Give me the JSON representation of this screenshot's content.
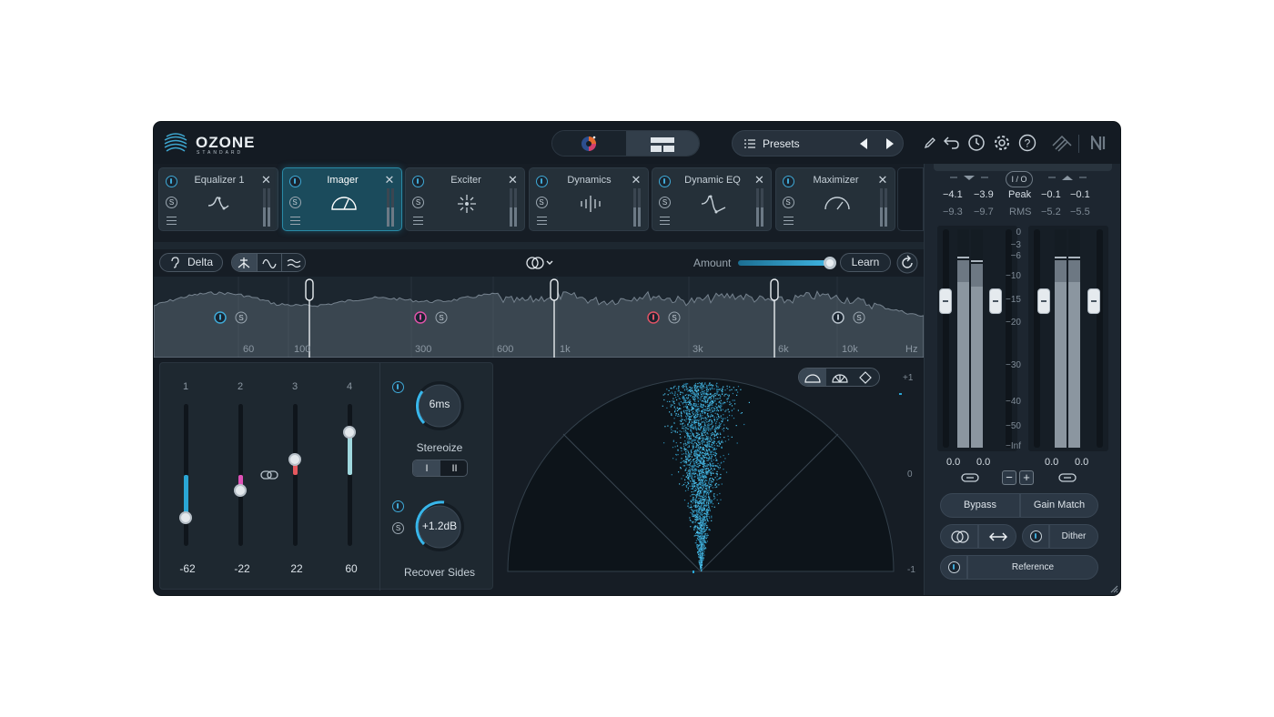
{
  "app": {
    "logo_title": "OZONE",
    "logo_subtitle": "STANDARD"
  },
  "header": {
    "presets_label": "Presets"
  },
  "modules": [
    {
      "name": "Equalizer 1",
      "active": false
    },
    {
      "name": "Imager",
      "active": true
    },
    {
      "name": "Exciter",
      "active": false
    },
    {
      "name": "Dynamics",
      "active": false
    },
    {
      "name": "Dynamic EQ",
      "active": false
    },
    {
      "name": "Maximizer",
      "active": false
    }
  ],
  "toolbar": {
    "delta_label": "Delta",
    "amount_label": "Amount",
    "amount_value": 0.97,
    "learn_label": "Learn"
  },
  "spectrum": {
    "freq_labels": [
      "60",
      "100",
      "300",
      "600",
      "1k",
      "3k",
      "6k",
      "10k",
      "Hz"
    ],
    "band_colors": [
      "#3fa9d6",
      "#e052a8",
      "#e05365",
      "#b8c2cb"
    ]
  },
  "bands": [
    {
      "num": "1",
      "value": "-62",
      "width_level": 0.2,
      "color": "#2aa6d5"
    },
    {
      "num": "2",
      "value": "-22",
      "width_level": 0.39,
      "color": "#e052b8"
    },
    {
      "num": "3",
      "value": "22",
      "width_level": 0.61,
      "color": "#e5585e"
    },
    {
      "num": "4",
      "value": "60",
      "width_level": 0.8,
      "color": "#9fd8de"
    }
  ],
  "stereoize": {
    "knob_value": "6ms",
    "label": "Stereoize",
    "modes": [
      "I",
      "II"
    ]
  },
  "recover": {
    "knob_value": "+1.2dB",
    "label": "Recover Sides"
  },
  "vectorscope": {
    "scale": [
      "+1",
      "0",
      "-1"
    ]
  },
  "meters": {
    "io_label": "I / O",
    "peak_label": "Peak",
    "rms_label": "RMS",
    "in_peak": [
      "−4.1",
      "−3.9"
    ],
    "in_rms": [
      "−9.3",
      "−9.7"
    ],
    "out_peak": [
      "−0.1",
      "−0.1"
    ],
    "out_rms": [
      "−5.2",
      "−5.5"
    ],
    "scale": [
      "0",
      "−3",
      "−6",
      "−10",
      "−15",
      "−20",
      "−30",
      "−40",
      "−50",
      "−Inf"
    ],
    "in_gain": [
      "0.0",
      "0.0"
    ],
    "out_gain": [
      "0.0",
      "0.0"
    ],
    "in_levels": [
      0.86,
      0.84
    ],
    "out_levels": [
      0.86,
      0.86
    ]
  },
  "buttons": {
    "bypass": "Bypass",
    "gain_match": "Gain Match",
    "dither": "Dither",
    "reference": "Reference"
  }
}
